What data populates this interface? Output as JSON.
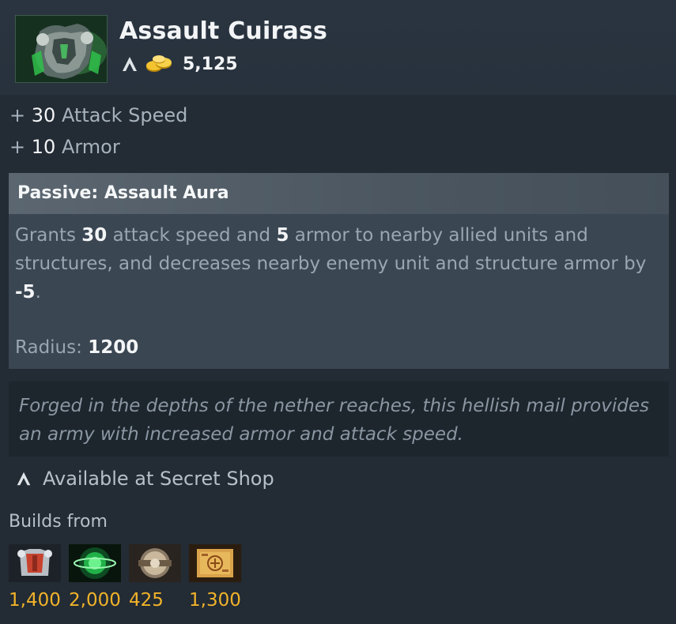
{
  "item": {
    "name": "Assault Cuirass",
    "icon": "cuirass-armor-icon",
    "cost": "5,125"
  },
  "stats": [
    {
      "prefix": "+",
      "value": "30",
      "label": "Attack Speed"
    },
    {
      "prefix": "+",
      "value": "10",
      "label": "Armor"
    }
  ],
  "ability": {
    "title": "Passive: Assault Aura",
    "desc_part1": "Grants ",
    "desc_val1": "30",
    "desc_part2": " attack speed and ",
    "desc_val2": "5",
    "desc_part3": " armor to nearby allied units and structures, and decreases nearby enemy unit and structure armor by ",
    "desc_val3": "-5",
    "desc_part4": ".",
    "radius_label": "Radius: ",
    "radius_value": "1200"
  },
  "lore": "Forged in the depths of the nether reaches, this hellish mail provides an army with increased armor and attack speed.",
  "availability": "Available at Secret Shop",
  "builds_from": {
    "label": "Builds from",
    "components": [
      {
        "icon": "chainmail-icon",
        "cost": "1,400"
      },
      {
        "icon": "hyperstone-icon",
        "cost": "2,000"
      },
      {
        "icon": "buckler-icon",
        "cost": "425"
      },
      {
        "icon": "recipe-scroll-icon",
        "cost": "1,300"
      }
    ]
  },
  "colors": {
    "background": "#232b34",
    "gold": "#f1b32a",
    "highlight": "#f2f4f6",
    "muted": "#a6b2bd"
  }
}
